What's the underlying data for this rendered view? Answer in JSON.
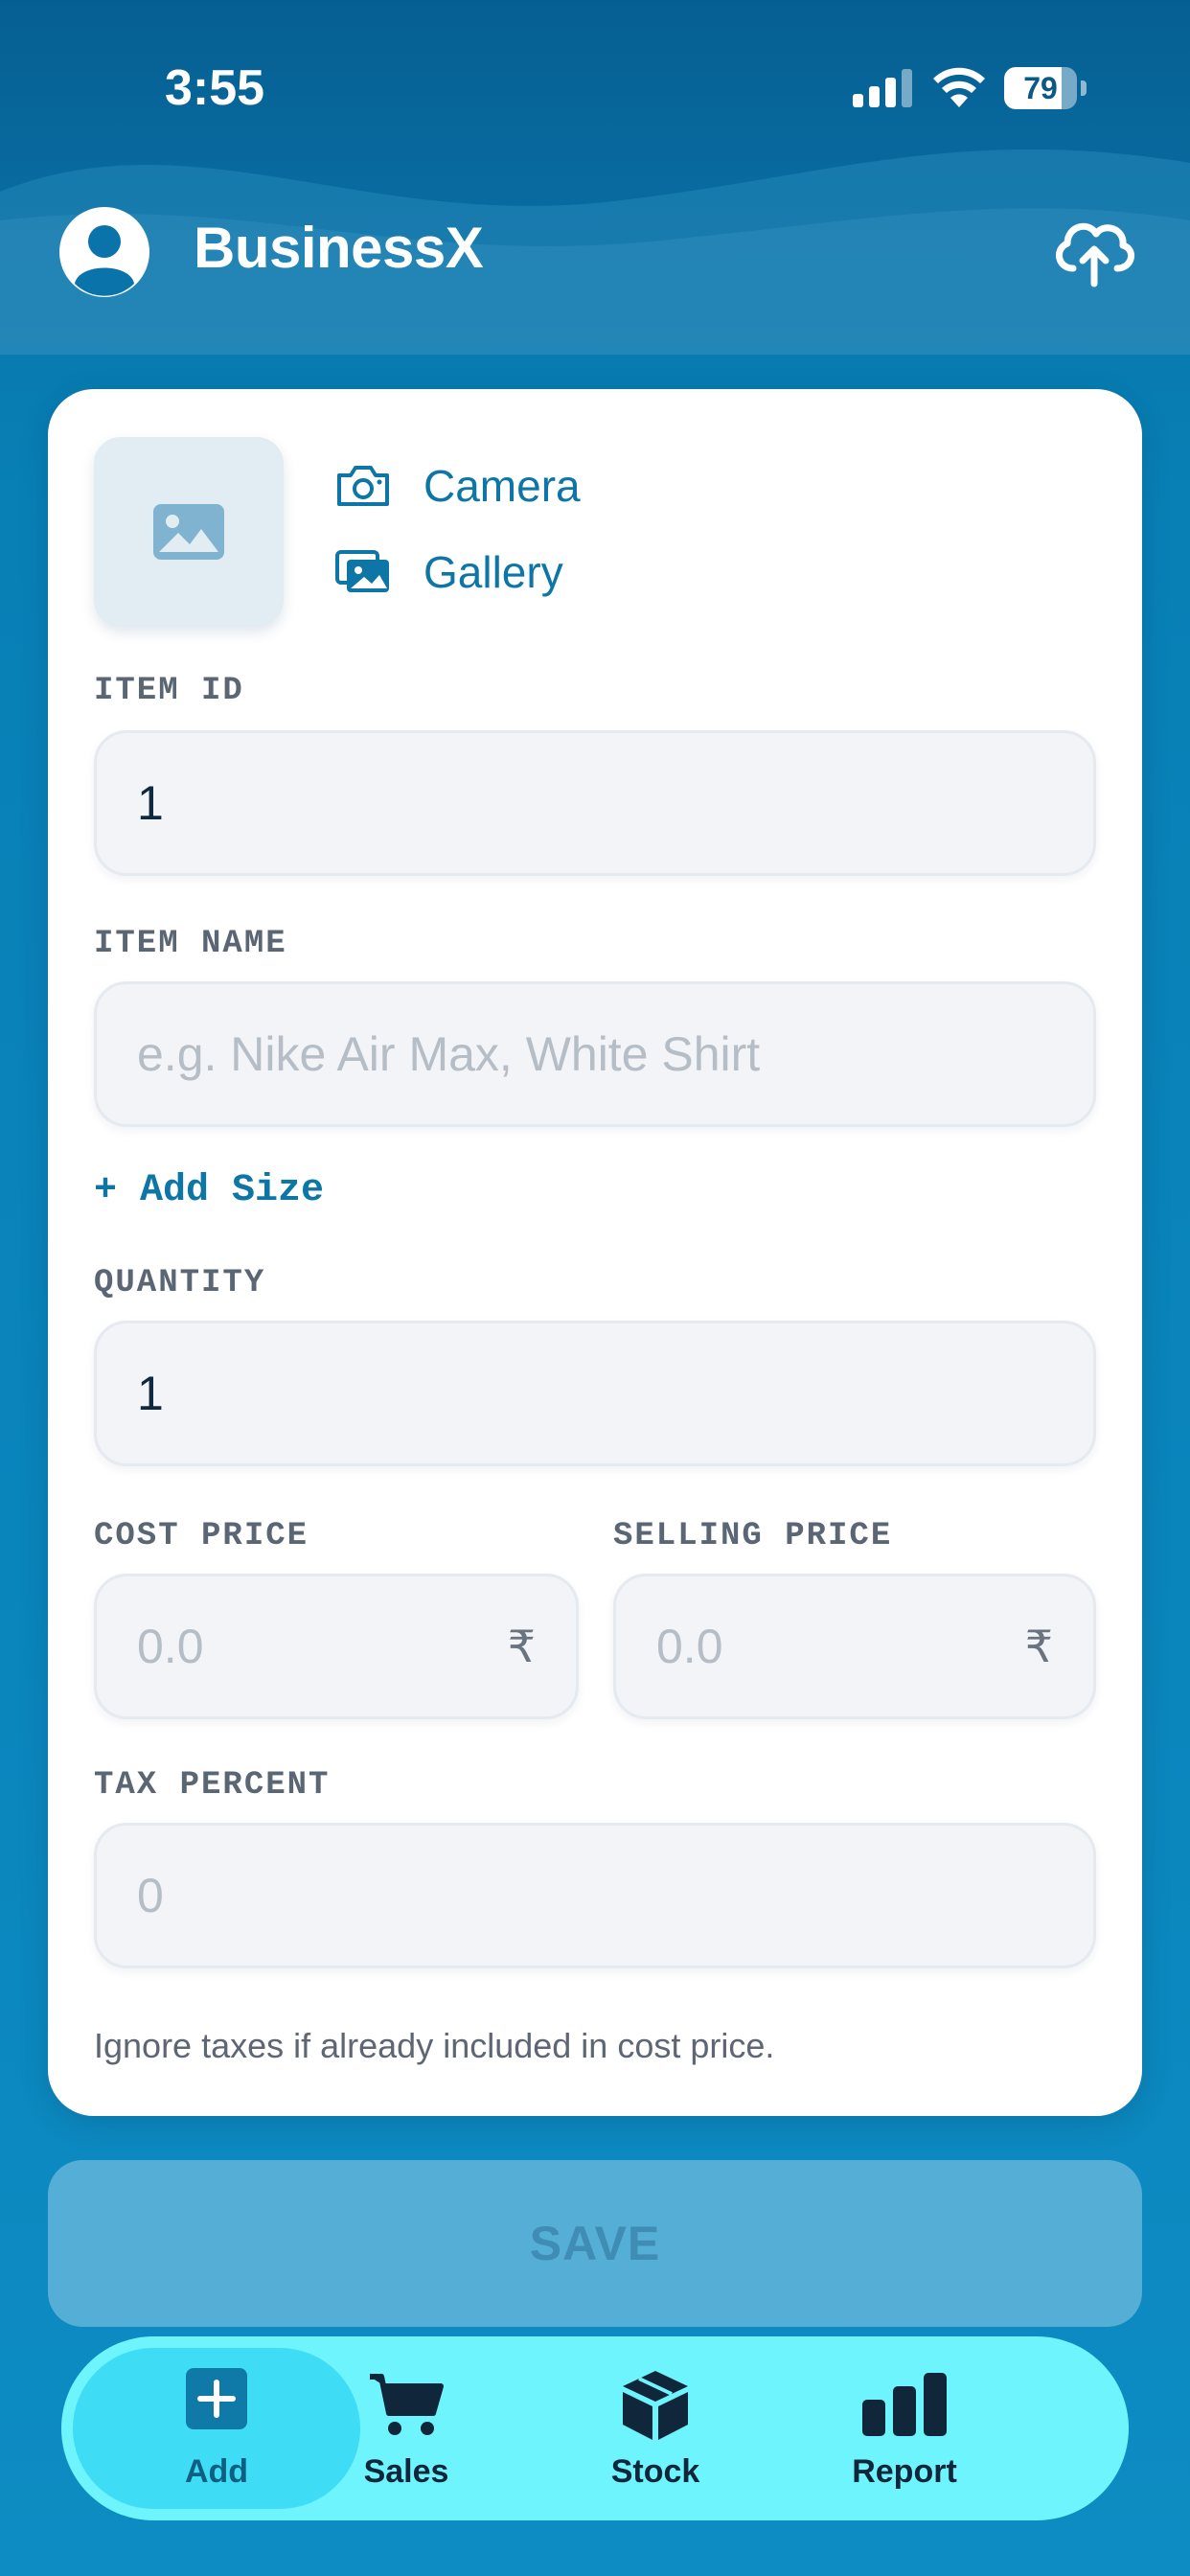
{
  "status_bar": {
    "time": "3:55",
    "battery_percent": "79",
    "battery_level": 0.79
  },
  "app_bar": {
    "title": "BusinessX",
    "avatar_icon": "account-circle-icon",
    "upload_icon": "cloud-upload-icon"
  },
  "media": {
    "placeholder_icon": "image-placeholder-icon",
    "camera_label": "Camera",
    "gallery_label": "Gallery"
  },
  "form": {
    "item_id": {
      "label": "ITEM ID",
      "value": "1"
    },
    "item_name": {
      "label": "ITEM NAME",
      "value": "",
      "placeholder": "e.g. Nike Air Max, White Shirt"
    },
    "add_size_label": "+ Add Size",
    "quantity": {
      "label": "QUANTITY",
      "value": "1"
    },
    "cost_price": {
      "label": "COST PRICE",
      "value": "",
      "placeholder": "0.0",
      "currency": "₹"
    },
    "selling_price": {
      "label": "SELLING PRICE",
      "value": "",
      "placeholder": "0.0",
      "currency": "₹"
    },
    "tax_percent": {
      "label": "TAX PERCENT",
      "value": "",
      "placeholder": "0"
    },
    "hint": "Ignore taxes if already included in cost price."
  },
  "save_label": "SAVE",
  "tabs": [
    {
      "label": "Add",
      "icon": "add-box-icon",
      "active": true
    },
    {
      "label": "Sales",
      "icon": "cart-icon",
      "active": false
    },
    {
      "label": "Stock",
      "icon": "box-icon",
      "active": false
    },
    {
      "label": "Report",
      "icon": "bar-chart-icon",
      "active": false
    }
  ],
  "colors": {
    "background": "#0a85bc",
    "accent": "#0d76a6",
    "tabbar": "#6ef4fc",
    "tab_active": "#3edcf5",
    "save_button": "#55aed5"
  }
}
